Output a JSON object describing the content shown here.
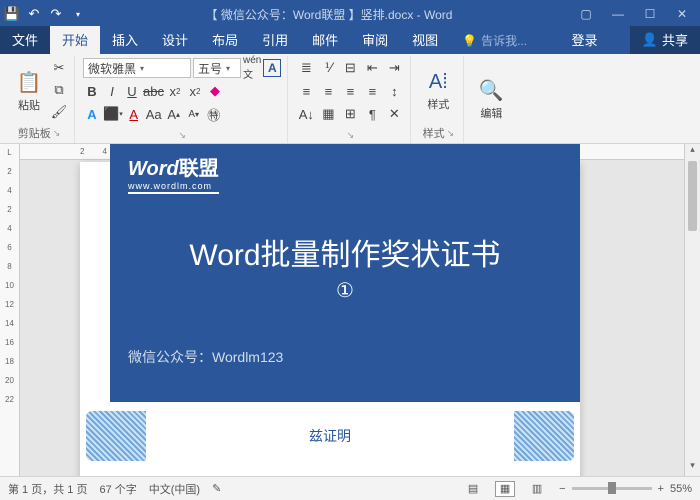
{
  "titlebar": {
    "title": "【 微信公众号：Word联盟 】竖排.docx - Word"
  },
  "tabs": {
    "file": "文件",
    "home": "开始",
    "insert": "插入",
    "design": "设计",
    "layout": "布局",
    "references": "引用",
    "mail": "邮件",
    "review": "审阅",
    "view": "视图",
    "tell": "告诉我...",
    "login": "登录",
    "share": "共享"
  },
  "ribbon": {
    "clipboard": {
      "label": "剪贴板",
      "paste": "粘贴"
    },
    "font": {
      "name": "微软雅黑",
      "size": "五号"
    },
    "styles": {
      "label": "样式",
      "btn": "样式"
    },
    "editing": {
      "label": "编辑",
      "btn": "编辑"
    }
  },
  "overlay": {
    "logo_main": "Word",
    "logo_cn": "联盟",
    "logo_url": "www.wordlm.com",
    "title": "Word批量制作奖状证书",
    "num": "①",
    "sub_label": "微信公众号：",
    "sub_val": "Wordlm123"
  },
  "doc": {
    "proof": "兹证明"
  },
  "status": {
    "page": "第 1 页，共 1 页",
    "words": "67 个字",
    "lang": "中文(中国)",
    "zoom": "55%"
  }
}
